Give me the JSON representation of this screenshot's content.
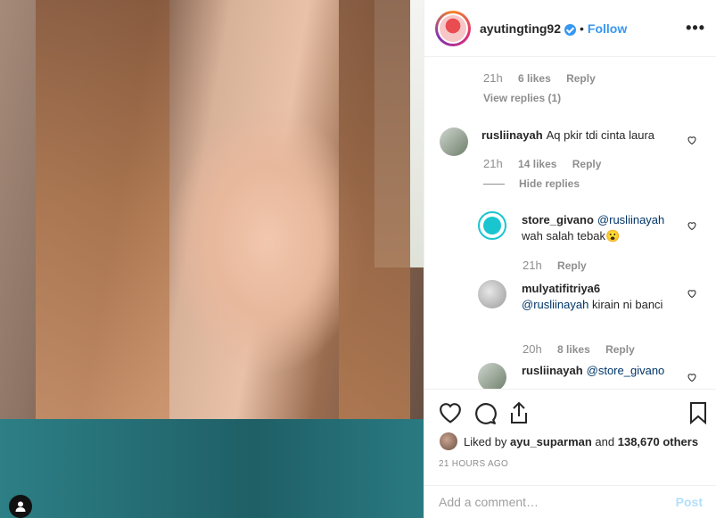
{
  "post": {
    "username": "ayutingting92",
    "separator": "•",
    "follow_label": "Follow",
    "more_label": "•••"
  },
  "comments": {
    "c0": {
      "time": "21h",
      "likes": "6 likes",
      "reply": "Reply",
      "view_replies": "View replies (1)"
    },
    "c1": {
      "user": "rusliinayah",
      "text": "Aq pkir tdi cinta laura",
      "time": "21h",
      "likes": "14 likes",
      "reply": "Reply",
      "hide_replies": "Hide replies"
    },
    "r1": {
      "user": "store_givano",
      "mention": "@rusliinayah",
      "text": "wah salah tebak😮",
      "time": "21h",
      "reply": "Reply"
    },
    "r2": {
      "user": "mulyatifitriya6",
      "mention": "@rusliinayah",
      "text": " kirain ni banci",
      "time": "20h",
      "likes": "8 likes",
      "reply": "Reply"
    },
    "r3": {
      "user": "rusliinayah",
      "mention": "@store_givano"
    }
  },
  "liked": {
    "prefix": "Liked by ",
    "user": "ayu_suparman",
    "middle": " and ",
    "count": "138,670 others"
  },
  "timestamp": "21 HOURS AGO",
  "add_comment": {
    "placeholder": "Add a comment…",
    "post_label": "Post"
  },
  "colors": {
    "accent": "#3897f0",
    "muted": "#8e8e8e",
    "mention": "#003569"
  }
}
